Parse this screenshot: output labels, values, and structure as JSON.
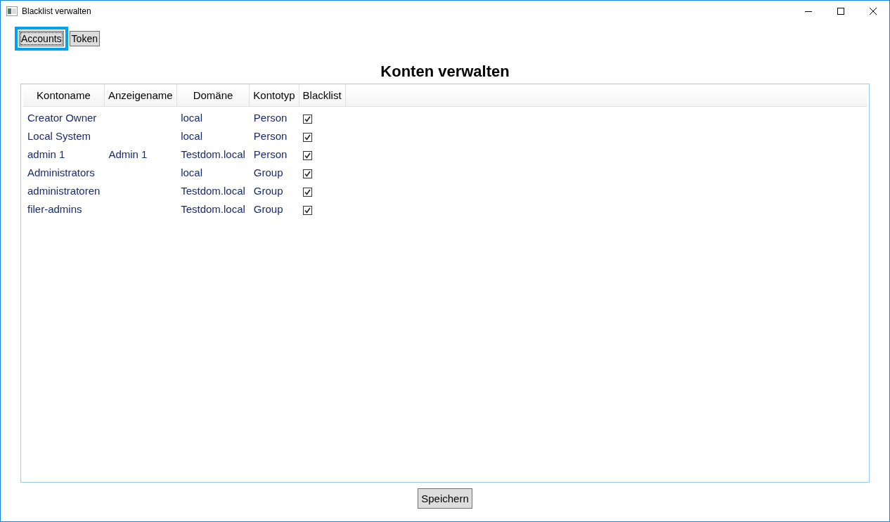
{
  "window": {
    "title": "Blacklist verwalten"
  },
  "tabs": [
    {
      "label": "Accounts",
      "selected": true
    },
    {
      "label": "Token",
      "selected": false
    }
  ],
  "heading": "Konten verwalten",
  "table": {
    "columns": [
      "Kontoname",
      "Anzeigename",
      "Domäne",
      "Kontotyp",
      "Blacklist"
    ],
    "rows": [
      {
        "name": "Creator Owner",
        "display": "",
        "domain": "local",
        "type": "Person",
        "blacklisted": true
      },
      {
        "name": "Local System",
        "display": "",
        "domain": "local",
        "type": "Person",
        "blacklisted": true
      },
      {
        "name": "admin 1",
        "display": "Admin 1",
        "domain": "Testdom.local",
        "type": "Person",
        "blacklisted": true
      },
      {
        "name": "Administrators",
        "display": "",
        "domain": "local",
        "type": "Group",
        "blacklisted": true
      },
      {
        "name": "administratoren",
        "display": "",
        "domain": "Testdom.local",
        "type": "Group",
        "blacklisted": true
      },
      {
        "name": "filer-admins",
        "display": "",
        "domain": "Testdom.local",
        "type": "Group",
        "blacklisted": true
      }
    ]
  },
  "save_button": "Speichern"
}
